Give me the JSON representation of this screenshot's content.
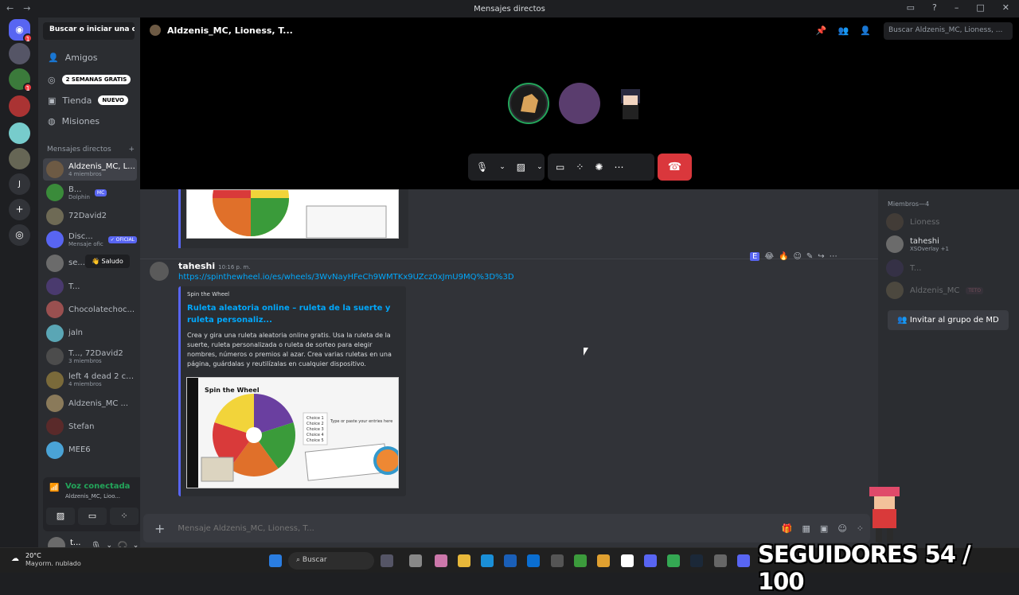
{
  "window": {
    "title": "Mensajes directos"
  },
  "sidebar": {
    "search_label": "Buscar o iniciar una co...",
    "nav": [
      {
        "label": "Amigos"
      },
      {
        "label": "",
        "badge": "2 SEMANAS GRATIS"
      },
      {
        "label": "Tienda",
        "badge": "NUEVO"
      },
      {
        "label": "Misiones"
      }
    ],
    "dm_header": "Mensajes directos",
    "dm_add": "+",
    "dms": [
      {
        "name": "Aldzenis_MC, L...",
        "sub": "4 miembros",
        "color": "#6d5a44"
      },
      {
        "name": "B...",
        "tag": "MC",
        "sub": "Dolphin",
        "color": "#3a8b3a"
      },
      {
        "name": "72David2",
        "sub": "",
        "color": "#6e6a55"
      },
      {
        "name": "Disc...",
        "tag": "✓ OFICIAL",
        "sub": "Mensaje oficial de Di...",
        "color": "#5865f2"
      },
      {
        "name": "se...",
        "sub": "",
        "color": "#6b6b6b"
      },
      {
        "name": "T...",
        "sub": "",
        "color": "#4a3a6e"
      },
      {
        "name": "Chocolatechoc...",
        "sub": "",
        "color": "#9a5050"
      },
      {
        "name": "jaln",
        "sub": "",
        "color": "#5aa6b5"
      },
      {
        "name": "T..., 72David2",
        "sub": "3 miembros",
        "color": "#4c4c4c"
      },
      {
        "name": "left 4 dead 2 co...",
        "sub": "4 miembros",
        "color": "#7a6a3a"
      },
      {
        "name": "Aldzenis_MC ...",
        "sub": "",
        "color": "#8a7a5a"
      },
      {
        "name": "Stefan",
        "sub": "",
        "color": "#5a2a2a"
      },
      {
        "name": "MEE6",
        "sub": "",
        "color": "#4aa3d6"
      }
    ],
    "saludo": "Saludo",
    "voice": {
      "status": "Voz conectada",
      "channel": "Aldzenis_MC, Lioo..."
    },
    "user": {
      "name": "t...",
      "sub": "+1"
    }
  },
  "call": {
    "title": "Aldzenis_MC, Lioness, T...",
    "search_placeholder": "Buscar Aldzenis_MC, Lioness, ..."
  },
  "chat": {
    "message": {
      "user": "taheshi",
      "time": "10:16 p. m.",
      "link": "https://spinthewheel.io/es/wheels/3WvNayHFeCh9WMTKx9UZcz0xJmU9MQ%3D%3D"
    },
    "embed": {
      "provider": "Spin the Wheel",
      "title": "Ruleta aleatoria online – ruleta de la suerte y ruleta personaliz...",
      "description": "Crea y gira una ruleta aleatoria online gratis. Usa la ruleta de la suerte, ruleta personalizada o ruleta de sorteo para elegir nombres, números o premios al azar. Crea varias ruletas en una página, guárdalas y reutilízalas en cualquier dispositivo."
    },
    "wheel": {
      "brand": "Spin the Wheel",
      "choices": [
        "Choice 1",
        "Choice 2",
        "Choice 3",
        "Choice 4",
        "Choice 5"
      ],
      "entry_hint": "Type or paste your entries here"
    },
    "composer_placeholder": "Mensaje Aldzenis_MC, Lioness, T..."
  },
  "members": {
    "header": "Miembros—4",
    "list": [
      {
        "name": "Lioness",
        "sub": "",
        "dim": true,
        "color": "#6d5a44"
      },
      {
        "name": "taheshi",
        "sub": "XSOverlay +1",
        "dim": false,
        "color": "#6b6b6b"
      },
      {
        "name": "T...",
        "sub": "",
        "dim": true,
        "color": "#4a3a6e"
      },
      {
        "name": "Aldzenis_MC",
        "tag": "TETO",
        "sub": "",
        "dim": true,
        "color": "#8a7a5a"
      }
    ],
    "invite": "Invitar al grupo de MD"
  },
  "taskbar": {
    "temp": "20°C",
    "weather": "Mayorm. nublado",
    "search": "Buscar"
  },
  "overlay": {
    "text": "SEGUIDORES 54 / 100"
  },
  "colors": {
    "accent": "#5865f2",
    "link": "#00a8fc",
    "danger": "#da373c",
    "voice": "#23a55a"
  }
}
